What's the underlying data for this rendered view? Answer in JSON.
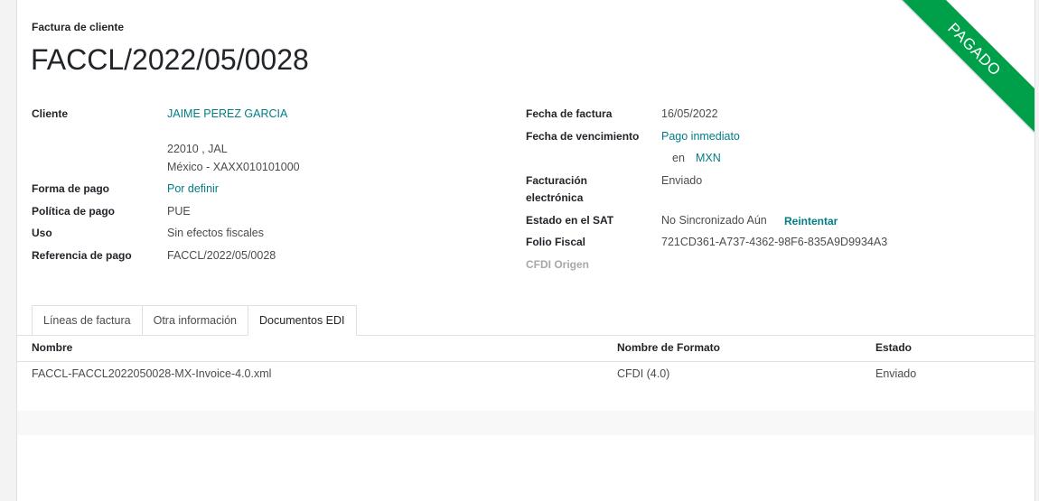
{
  "header": {
    "doc_type": "Factura de cliente",
    "number": "FACCL/2022/05/0028",
    "ribbon": "PAGADO"
  },
  "left": {
    "cliente_label": "Cliente",
    "cliente": "JAIME PEREZ GARCIA",
    "addr1": "22010 , JAL",
    "addr2": "México - XAXX010101000",
    "forma_label": "Forma de pago",
    "forma": "Por definir",
    "politica_label": "Política de pago",
    "politica": "PUE",
    "uso_label": "Uso",
    "uso": "Sin efectos fiscales",
    "ref_label": "Referencia de pago",
    "ref": "FACCL/2022/05/0028"
  },
  "right": {
    "fecha_label": "Fecha de factura",
    "fecha": "16/05/2022",
    "venc_label": "Fecha de vencimiento",
    "venc": "Pago inmediato",
    "en": "en",
    "currency": "MXN",
    "fact_label_1": "Facturación",
    "fact_label_2": "electrónica",
    "fact": "Enviado",
    "sat_label": "Estado en el SAT",
    "sat": "No Sincronizado Aún",
    "retry": "Reintentar",
    "folio_label": "Folio Fiscal",
    "folio": "721CD361-A737-4362-98F6-835A9D9934A3",
    "cfdi_label": "CFDI Origen"
  },
  "tabs": [
    "Líneas de factura",
    "Otra información",
    "Documentos EDI"
  ],
  "table": {
    "columns": [
      "Nombre",
      "Nombre de Formato",
      "Estado"
    ],
    "rows": [
      [
        "FACCL-FACCL2022050028-MX-Invoice-4.0.xml",
        "CFDI (4.0)",
        "Enviado"
      ]
    ]
  },
  "colors": {
    "accent": "#017e84",
    "ribbon": "#00a04a"
  }
}
